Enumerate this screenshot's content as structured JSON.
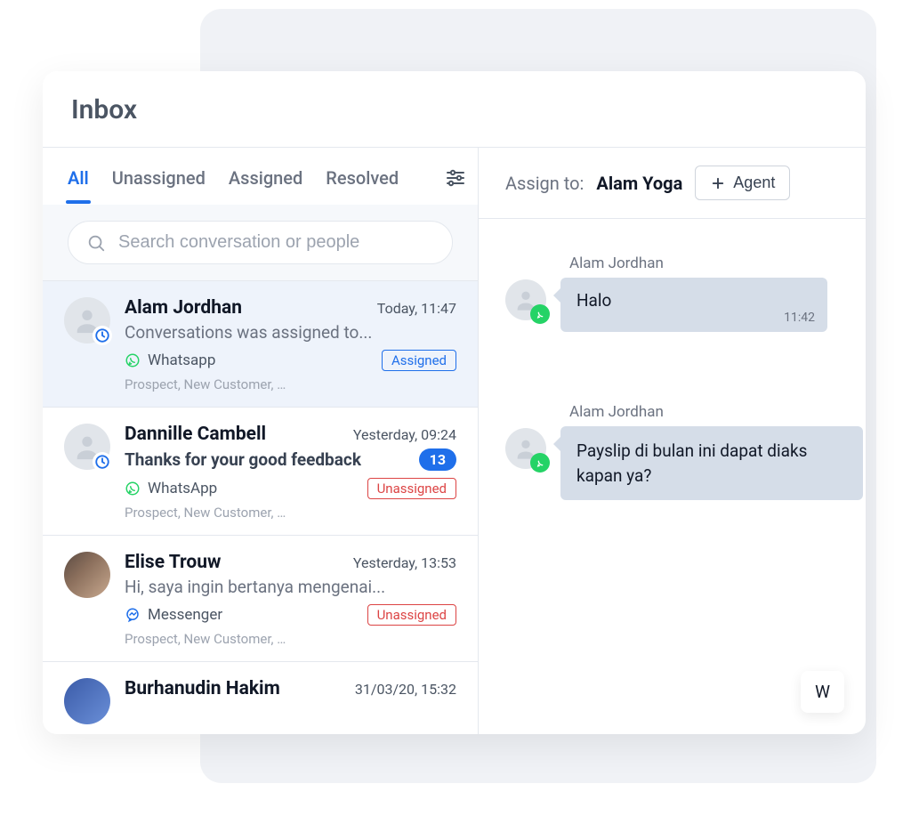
{
  "title": "Inbox",
  "filters": {
    "all": "All",
    "unassigned": "Unassigned",
    "assigned": "Assigned",
    "resolved": "Resolved"
  },
  "search": {
    "placeholder": "Search conversation or people"
  },
  "conversations": [
    {
      "name": "Alam Jordhan",
      "time": "Today, 11:47",
      "preview": "Conversations was assigned to...",
      "channel": "Whatsapp",
      "status": "Assigned",
      "tags": "Prospect, New Customer, …"
    },
    {
      "name": "Dannille Cambell",
      "time": "Yesterday, 09:24",
      "preview": "Thanks for your good feedback",
      "unread": "13",
      "channel": "WhatsApp",
      "status": "Unassigned",
      "tags": "Prospect, New Customer, …"
    },
    {
      "name": "Elise Trouw",
      "time": "Yesterday, 13:53",
      "preview": "Hi, saya ingin bertanya mengenai...",
      "channel": "Messenger",
      "status": "Unassigned",
      "tags": "Prospect, New Customer, …"
    },
    {
      "name": "Burhanudin Hakim",
      "time": "31/03/20, 15:32"
    }
  ],
  "assign": {
    "label": "Assign to:",
    "assignee": "Alam Yoga",
    "agent_btn": "Agent"
  },
  "messages": [
    {
      "sender": "Alam Jordhan",
      "text": "Halo",
      "time": "11:42"
    },
    {
      "sender": "Alam Jordhan",
      "text": "Payslip di bulan ini dapat diaks kapan ya?"
    }
  ],
  "reply_stub": "W"
}
